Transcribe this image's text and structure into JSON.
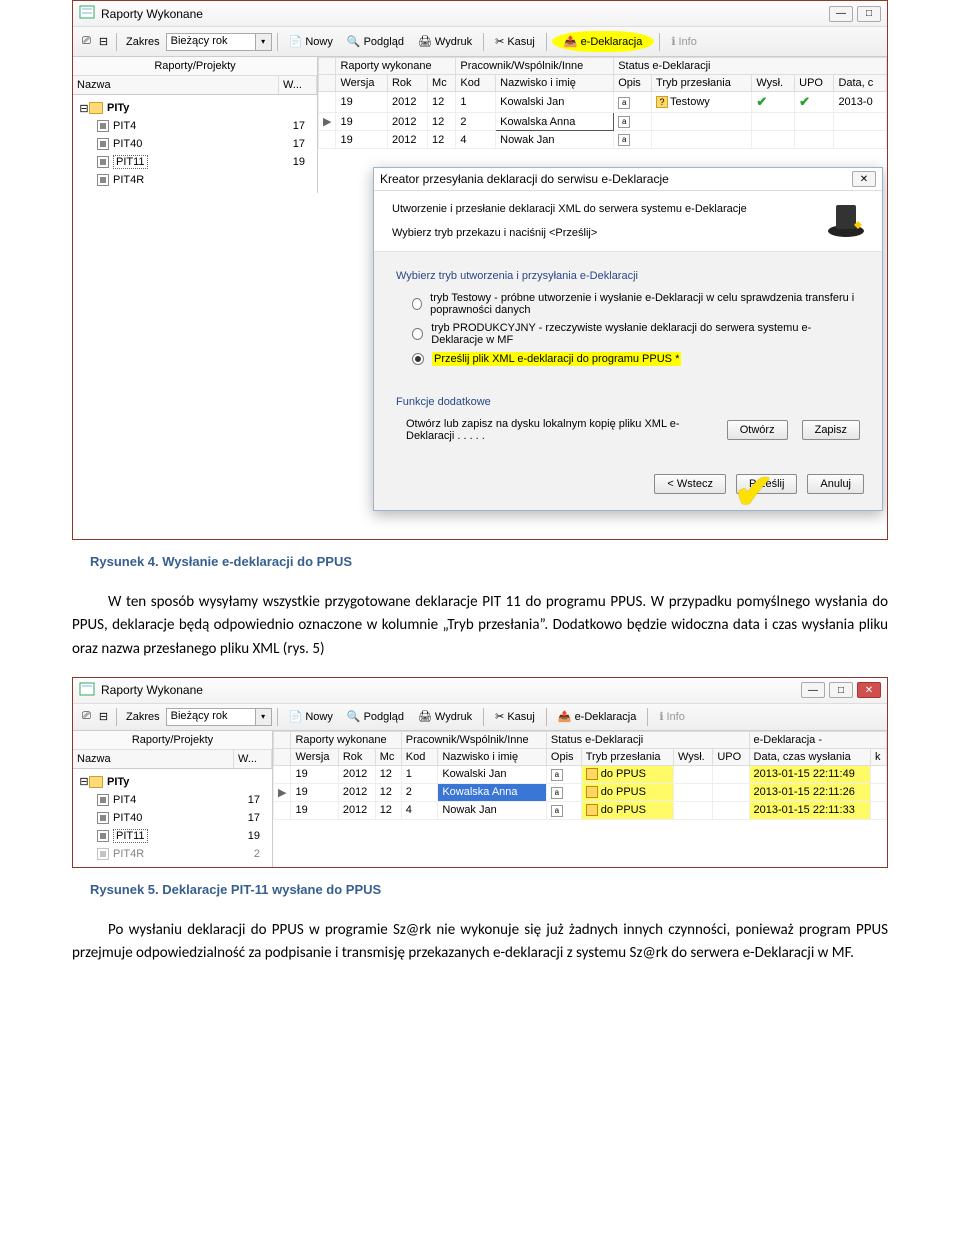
{
  "ss1": {
    "title": "Raporty Wykonane",
    "toolbar": {
      "zakres_label": "Zakres",
      "zakres_value": "Bieżący rok",
      "nowy": "Nowy",
      "podglad": "Podgląd",
      "wydruk": "Wydruk",
      "kasuj": "Kasuj",
      "edekl": "e-Deklaracja",
      "info": "Info"
    },
    "left": {
      "group": "Raporty/Projekty",
      "col_nazwa": "Nazwa",
      "col_w": "W...",
      "root": "PITy",
      "items": [
        {
          "name": "PIT4",
          "w": "17"
        },
        {
          "name": "PIT40",
          "w": "17"
        },
        {
          "name": "PIT11",
          "w": "19"
        },
        {
          "name": "PIT4R",
          "w": ""
        }
      ]
    },
    "grid": {
      "g1": "Raporty wykonane",
      "g2": "Pracownik/Wspólnik/Inne",
      "g3": "Status e-Deklaracji",
      "h": {
        "wersja": "Wersja",
        "rok": "Rok",
        "mc": "Mc",
        "kod": "Kod",
        "nazw": "Nazwisko i imię",
        "opis": "Opis",
        "tryb": "Tryb przesłania",
        "wysl": "Wysł.",
        "upo": "UPO",
        "data": "Data, c"
      },
      "rows": [
        {
          "wersja": "19",
          "rok": "2012",
          "mc": "12",
          "kod": "1",
          "nazw": "Kowalski Jan",
          "opis": "a",
          "tryb": "Testowy",
          "wysl": "✔",
          "upo": "✔",
          "data": "2013-0",
          "marker": "",
          "trybq": true
        },
        {
          "wersja": "19",
          "rok": "2012",
          "mc": "12",
          "kod": "2",
          "nazw": "Kowalska Anna",
          "opis": "a",
          "tryb": "",
          "wysl": "",
          "upo": "",
          "data": "",
          "marker": "▶",
          "sel": true
        },
        {
          "wersja": "19",
          "rok": "2012",
          "mc": "12",
          "kod": "4",
          "nazw": "Nowak Jan",
          "opis": "a",
          "tryb": "",
          "wysl": "",
          "upo": "",
          "data": "",
          "marker": ""
        }
      ]
    }
  },
  "wizard": {
    "title": "Kreator przesyłania deklaracji do serwisu e-Deklaracje",
    "line1": "Utworzenie i przesłanie deklaracji XML do serwera systemu e-Deklaracje",
    "line2": "Wybierz tryb przekazu i naciśnij <Prześlij>",
    "sec1": "Wybierz tryb utworzenia i przysyłania e-Deklaracji",
    "opt1": "tryb Testowy - próbne utworzenie i wysłanie e-Deklaracji w celu sprawdzenia transferu i poprawności danych",
    "opt2": "tryb PRODUKCYJNY - rzeczywiste wysłanie deklaracji do serwera systemu e-Deklaracje w MF",
    "opt3": "Prześlij plik XML e-deklaracji do programu  PPUS *",
    "sec2": "Funkcje dodatkowe",
    "func": "Otwórz lub zapisz na dysku lokalnym kopię pliku XML e-Deklaracji  . . . . .",
    "otworz": "Otwórz",
    "zapisz": "Zapisz",
    "wstecz": "< Wstecz",
    "przeslij": "Prześlij",
    "anuluj": "Anuluj"
  },
  "cap1": "Rysunek 4. Wysłanie e-deklaracji do PPUS",
  "para1": "W ten sposób wysyłamy wszystkie przygotowane deklaracje PIT 11  do programu PPUS. W przypadku pomyślnego wysłania do PPUS, deklaracje będą odpowiednio oznaczone w kolumnie „Tryb przesłania”.  Dodatkowo będzie widoczna data i czas wysłania pliku oraz nazwa przesłanego pliku XML (rys. 5)",
  "ss2": {
    "title": "Raporty Wykonane",
    "toolbar": {
      "zakres_label": "Zakres",
      "zakres_value": "Bieżący rok",
      "nowy": "Nowy",
      "podglad": "Podgląd",
      "wydruk": "Wydruk",
      "kasuj": "Kasuj",
      "edekl": "e-Deklaracja",
      "info": "Info"
    },
    "left": {
      "group": "Raporty/Projekty",
      "col_nazwa": "Nazwa",
      "col_w": "W...",
      "root": "PITy",
      "items": [
        {
          "name": "PIT4",
          "w": "17"
        },
        {
          "name": "PIT40",
          "w": "17"
        },
        {
          "name": "PIT11",
          "w": "19"
        },
        {
          "name": "PIT4R",
          "w": "2"
        }
      ]
    },
    "grid": {
      "g1": "Raporty wykonane",
      "g2": "Pracownik/Wspólnik/Inne",
      "g3": "Status e-Deklaracji",
      "g4": "e-Deklaracja -",
      "h": {
        "wersja": "Wersja",
        "rok": "Rok",
        "mc": "Mc",
        "kod": "Kod",
        "nazw": "Nazwisko i imię",
        "opis": "Opis",
        "tryb": "Tryb przesłania",
        "wysl": "Wysł.",
        "upo": "UPO",
        "data": "Data, czas wysłania",
        "k": "k"
      },
      "rows": [
        {
          "wersja": "19",
          "rok": "2012",
          "mc": "12",
          "kod": "1",
          "nazw": "Kowalski Jan",
          "opis": "a",
          "tryb": "do PPUS",
          "data": "2013-01-15 22:11:49",
          "marker": ""
        },
        {
          "wersja": "19",
          "rok": "2012",
          "mc": "12",
          "kod": "2",
          "nazw": "Kowalska Anna",
          "opis": "a",
          "tryb": "do PPUS",
          "data": "2013-01-15 22:11:26",
          "marker": "▶",
          "sel": true
        },
        {
          "wersja": "19",
          "rok": "2012",
          "mc": "12",
          "kod": "4",
          "nazw": "Nowak Jan",
          "opis": "a",
          "tryb": "do PPUS",
          "data": "2013-01-15 22:11:33",
          "marker": ""
        }
      ]
    }
  },
  "cap2": "Rysunek 5. Deklaracje PIT-11 wysłane do PPUS",
  "para2": "Po wysłaniu deklaracji do PPUS w programie Sz@rk nie wykonuje się już żadnych innych czynności, ponieważ program PPUS przejmuje odpowiedzialność za podpisanie i transmisję przekazanych e-deklaracji z systemu Sz@rk do serwera e-Deklaracji w MF."
}
